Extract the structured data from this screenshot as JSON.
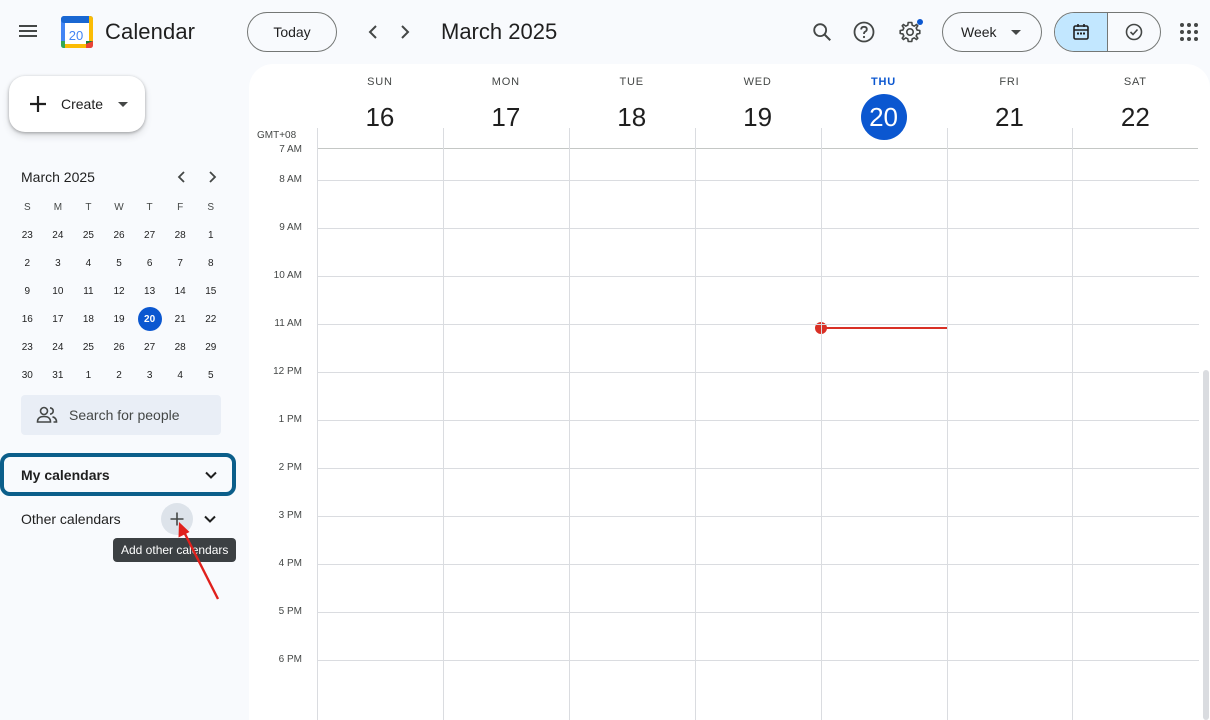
{
  "header": {
    "app_title": "Calendar",
    "logo_day": "20",
    "today_label": "Today",
    "month_title": "March 2025",
    "view_label": "Week"
  },
  "sidebar": {
    "create_label": "Create",
    "mini_calendar": {
      "title": "March 2025",
      "weekday_headers": [
        "S",
        "M",
        "T",
        "W",
        "T",
        "F",
        "S"
      ],
      "weeks": [
        [
          "23",
          "24",
          "25",
          "26",
          "27",
          "28",
          "1"
        ],
        [
          "2",
          "3",
          "4",
          "5",
          "6",
          "7",
          "8"
        ],
        [
          "9",
          "10",
          "11",
          "12",
          "13",
          "14",
          "15"
        ],
        [
          "16",
          "17",
          "18",
          "19",
          "20",
          "21",
          "22"
        ],
        [
          "23",
          "24",
          "25",
          "26",
          "27",
          "28",
          "29"
        ],
        [
          "30",
          "31",
          "1",
          "2",
          "3",
          "4",
          "5"
        ]
      ],
      "today": "20"
    },
    "search_people_placeholder": "Search for people",
    "my_calendars_label": "My calendars",
    "other_calendars_label": "Other calendars",
    "add_other_tooltip": "Add other calendars"
  },
  "week": {
    "timezone": "GMT+08",
    "days": [
      {
        "name": "SUN",
        "num": "16"
      },
      {
        "name": "MON",
        "num": "17"
      },
      {
        "name": "TUE",
        "num": "18"
      },
      {
        "name": "WED",
        "num": "19"
      },
      {
        "name": "THU",
        "num": "20",
        "today": true
      },
      {
        "name": "FRI",
        "num": "21"
      },
      {
        "name": "SAT",
        "num": "22"
      }
    ],
    "hours": [
      "7 AM",
      "8 AM",
      "9 AM",
      "10 AM",
      "11 AM",
      "12 PM",
      "1 PM",
      "2 PM",
      "3 PM",
      "4 PM",
      "5 PM",
      "6 PM"
    ]
  },
  "colors": {
    "accent": "#0b57d0",
    "now_line": "#d93025",
    "highlight_border": "#0b5e8a"
  }
}
